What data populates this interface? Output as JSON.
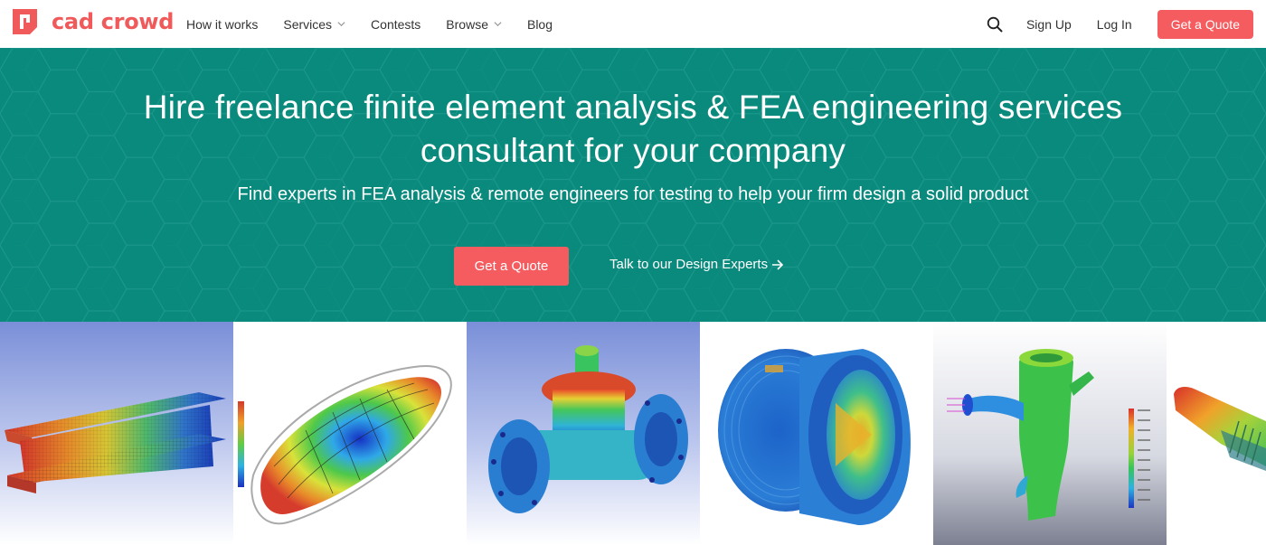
{
  "brand": {
    "name": "cad crowd",
    "color": "#f05a5b"
  },
  "nav": {
    "links": [
      {
        "label": "How it works",
        "dropdown": false
      },
      {
        "label": "Services",
        "dropdown": true
      },
      {
        "label": "Contests",
        "dropdown": false
      },
      {
        "label": "Browse",
        "dropdown": true
      },
      {
        "label": "Blog",
        "dropdown": false
      }
    ],
    "search_icon": "search-icon",
    "sign_up": "Sign Up",
    "log_in": "Log In",
    "get_quote": "Get a Quote"
  },
  "hero": {
    "title_line1": "Hire freelance finite element analysis & FEA engineering services",
    "title_line2": "consultant for your company",
    "subtitle": "Find experts in FEA analysis & remote engineers for testing to help your firm design a solid product",
    "cta": "Get a Quote",
    "talk_link": "Talk to our Design Experts",
    "background_color": "#0a8a7d",
    "accent_color": "#f45c5f"
  },
  "gallery": {
    "images": [
      {
        "name": "i-beam-fea-image"
      },
      {
        "name": "shell-mesh-fea-image"
      },
      {
        "name": "valve-fea-image"
      },
      {
        "name": "pipe-fitting-fea-image"
      },
      {
        "name": "manifold-fea-image"
      },
      {
        "name": "shaft-fea-image"
      }
    ]
  }
}
